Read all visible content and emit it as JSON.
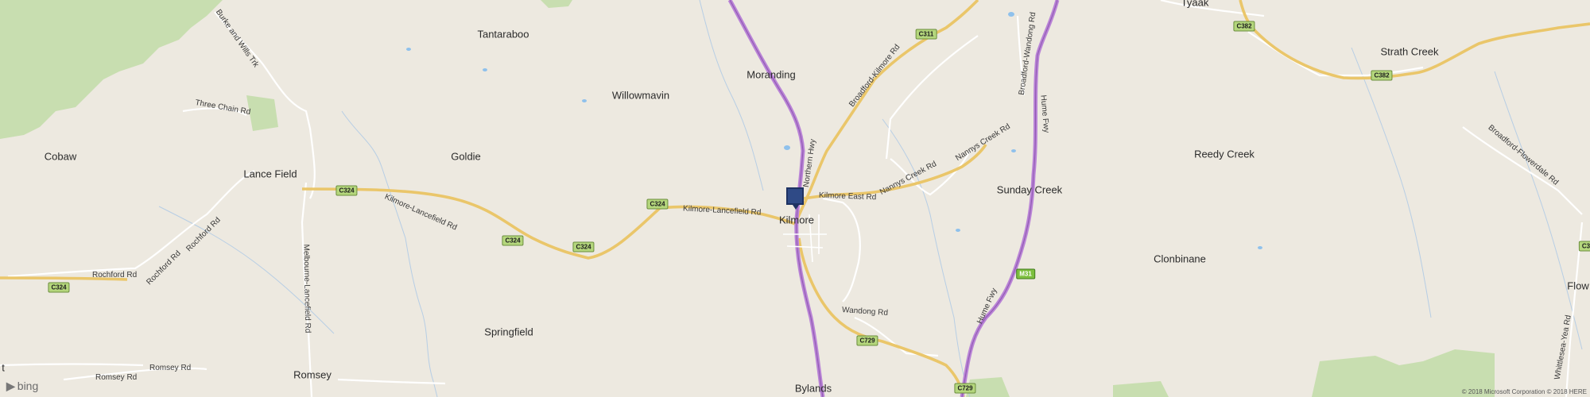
{
  "map": {
    "places": [
      {
        "name": "Tantaraboo"
      },
      {
        "name": "Moranding"
      },
      {
        "name": "Willowmavin"
      },
      {
        "name": "Cobaw"
      },
      {
        "name": "Goldie"
      },
      {
        "name": "Lance Field"
      },
      {
        "name": "Kilmore"
      },
      {
        "name": "Sunday Creek"
      },
      {
        "name": "Reedy Creek"
      },
      {
        "name": "Clonbinane"
      },
      {
        "name": "Springfield"
      },
      {
        "name": "Romsey"
      },
      {
        "name": "Bylands"
      },
      {
        "name": "Tyaak"
      },
      {
        "name": "Strath Creek"
      },
      {
        "name": "Flow"
      },
      {
        "name": "t"
      }
    ],
    "roads": [
      "Burke and Wills Trk",
      "Three Chain Rd",
      "Kilmore-Lancefield Rd",
      "Kilmore-Lancefield Rd",
      "Rochford Rd",
      "Rochford Rd",
      "Rochford Rd",
      "Melbourne-Lancefield Rd",
      "Romsey Rd",
      "Romsey Rd",
      "Broadford-Kilmore Rd",
      "Northern Hwy",
      "Kilmore East Rd",
      "Nannys Creek Rd",
      "Nannys Creek Rd",
      "Broadford-Wandong Rd",
      "Hume Fwy",
      "Hume Fwy",
      "Wandong Rd",
      "Broadford-Flowerdale Rd",
      "Whittlesea-Yea Rd"
    ],
    "shields": [
      "C324",
      "C324",
      "C324",
      "C324",
      "C324",
      "C311",
      "C382",
      "C382",
      "M31",
      "C729",
      "C729",
      "C3"
    ]
  },
  "marker": {
    "label": "Kilmore"
  },
  "attribution": {
    "logo": "bing",
    "copyright": "© 2018 Microsoft Corporation © 2018 HERE"
  },
  "colors": {
    "land": "#ede9e0",
    "forest": "#c8deb0",
    "highway": "#b983d6",
    "major_road": "#f2d27a",
    "minor_road": "#ffffff",
    "water": "#8fc1ec",
    "marker": "#2f4a86"
  }
}
